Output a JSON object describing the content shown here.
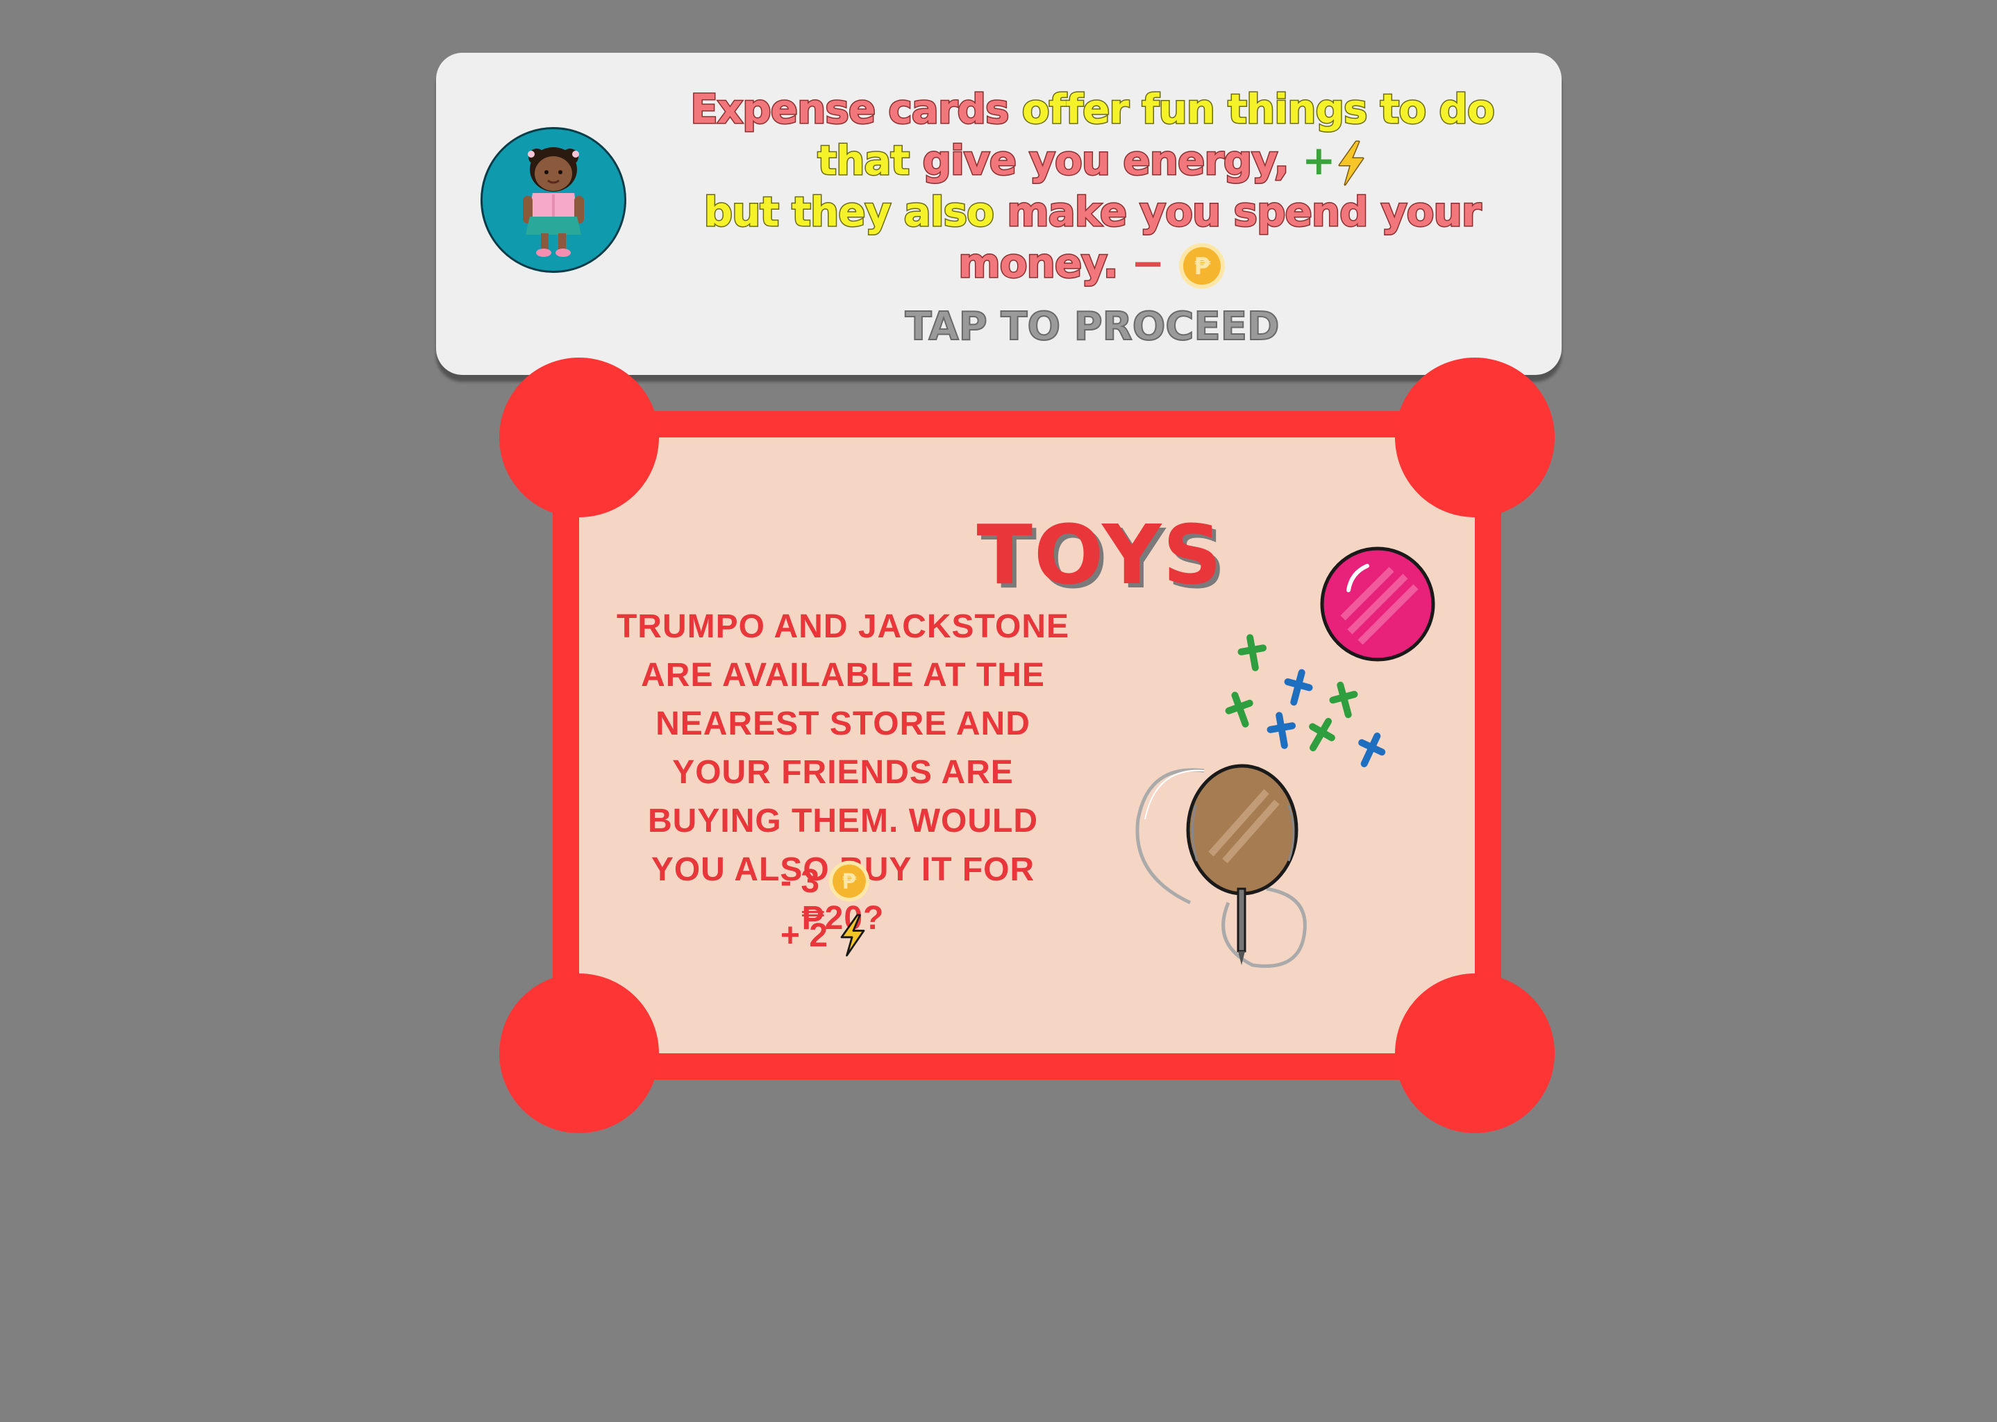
{
  "instruction": {
    "line1_part1": "Expense cards",
    "line1_part2": "offer fun things to do",
    "line2_part1": "that",
    "line2_part2": "give you energy,",
    "energy_sign": "+",
    "line3_part1": "but they also",
    "line3_part2": "make you spend your",
    "line4_part1": "money.",
    "money_sign": "−",
    "tap_label": "TAP TO PROCEED"
  },
  "card": {
    "title": "TOYS",
    "description": "TRUMPO AND JACKSTONE ARE AVAILABLE AT THE NEAREST STORE AND YOUR FRIENDS ARE BUYING THEM. WOULD YOU ALSO BUY IT FOR ₱20?",
    "money_change": "- 3",
    "energy_change": "+ 2"
  },
  "colors": {
    "background": "#808080",
    "card_red": "#fe3535",
    "card_bg": "#f5d6c4",
    "text_red": "#e8363a",
    "pink": "#f2777c",
    "yellow": "#f6f22a"
  },
  "icons": [
    "avatar-girl",
    "peso-coin-icon",
    "lightning-icon",
    "ball-icon",
    "jackstone-icon",
    "trumpo-icon"
  ]
}
